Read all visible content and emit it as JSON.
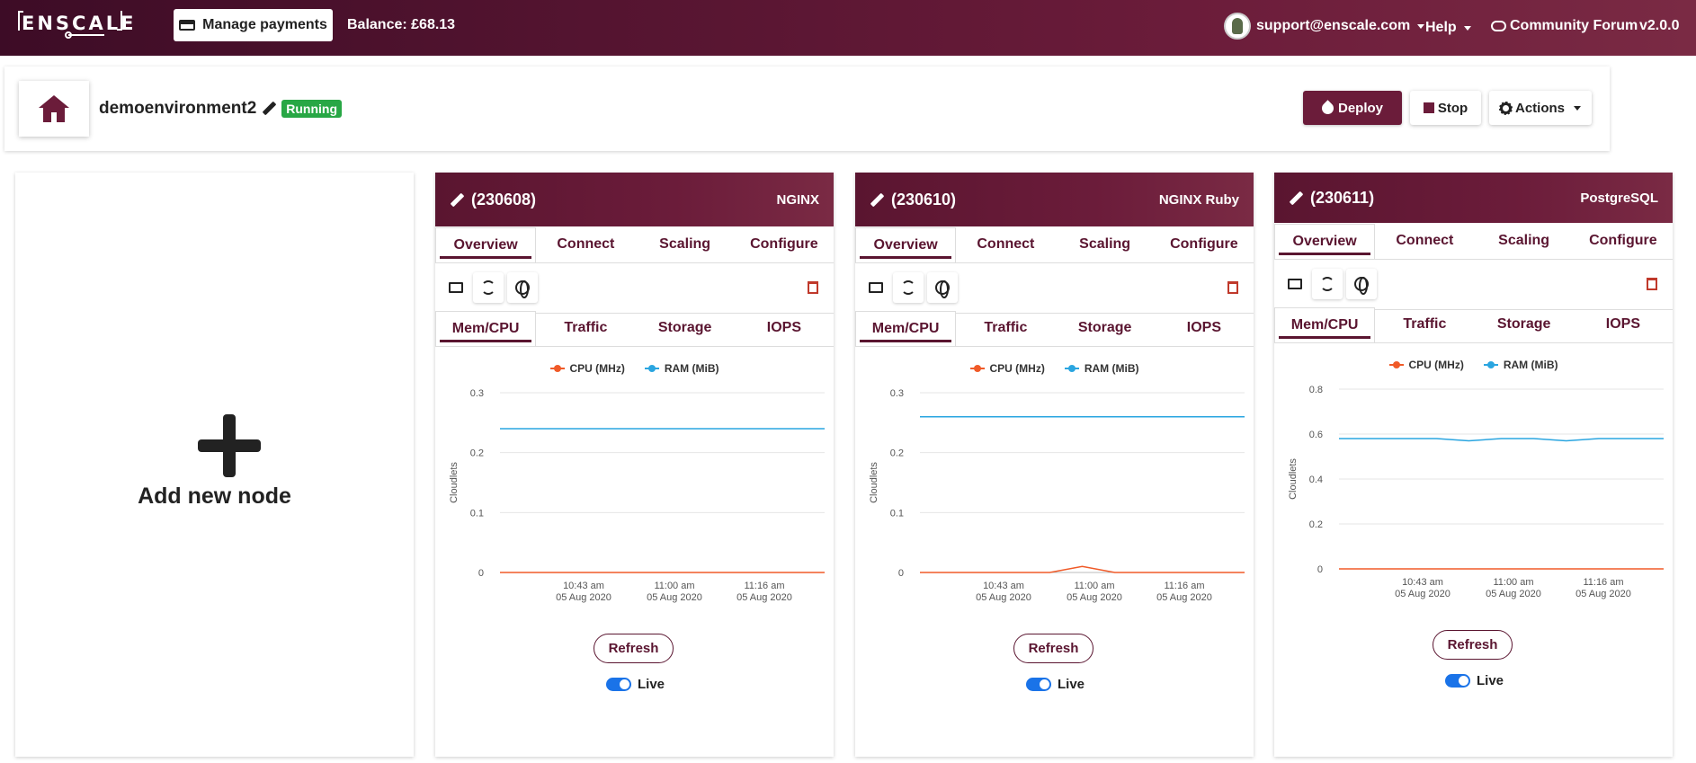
{
  "nav": {
    "logo": "ENSCALE",
    "manage_payments": "Manage payments",
    "balance": "Balance: £68.13",
    "user": "support@enscale.com",
    "help": "Help",
    "forum": "Community Forum",
    "version": "v2.0.0"
  },
  "env": {
    "name": "demoenvironment2",
    "status": "Running",
    "deploy": "Deploy",
    "stop": "Stop",
    "actions": "Actions"
  },
  "add_node": {
    "label": "Add new node"
  },
  "colors": {
    "brand": "#6b1c3a",
    "cpu": "#f05a28",
    "ram": "#2aa5e0",
    "running": "#28a745"
  },
  "nodes": [
    {
      "id": "(230608)",
      "type": "NGINX",
      "tabs": [
        "Overview",
        "Connect",
        "Scaling",
        "Configure"
      ],
      "metric_tabs": [
        "Mem/CPU",
        "Traffic",
        "Storage",
        "IOPS"
      ],
      "legend": [
        "CPU (MHz)",
        "RAM (MiB)"
      ],
      "refresh": "Refresh",
      "live": "Live",
      "chart_data": {
        "type": "line",
        "ylabel": "Cloudlets",
        "yticks": [
          "0.3",
          "0.2",
          "0.1",
          "0"
        ],
        "ylim": [
          0,
          0.3
        ],
        "xticks": [
          [
            "10:43 am",
            "05 Aug 2020"
          ],
          [
            "11:00 am",
            "05 Aug 2020"
          ],
          [
            "11:16 am",
            "05 Aug 2020"
          ]
        ],
        "series": [
          {
            "name": "CPU (MHz)",
            "values": [
              0,
              0,
              0,
              0,
              0,
              0,
              0,
              0,
              0,
              0,
              0
            ]
          },
          {
            "name": "RAM (MiB)",
            "values": [
              0.24,
              0.24,
              0.24,
              0.24,
              0.24,
              0.24,
              0.24,
              0.24,
              0.24,
              0.24,
              0.24
            ]
          }
        ]
      }
    },
    {
      "id": "(230610)",
      "type": "NGINX Ruby",
      "tabs": [
        "Overview",
        "Connect",
        "Scaling",
        "Configure"
      ],
      "metric_tabs": [
        "Mem/CPU",
        "Traffic",
        "Storage",
        "IOPS"
      ],
      "legend": [
        "CPU (MHz)",
        "RAM (MiB)"
      ],
      "refresh": "Refresh",
      "live": "Live",
      "chart_data": {
        "type": "line",
        "ylabel": "Cloudlets",
        "yticks": [
          "0.3",
          "0.2",
          "0.1",
          "0"
        ],
        "ylim": [
          0,
          0.3
        ],
        "xticks": [
          [
            "10:43 am",
            "05 Aug 2020"
          ],
          [
            "11:00 am",
            "05 Aug 2020"
          ],
          [
            "11:16 am",
            "05 Aug 2020"
          ]
        ],
        "series": [
          {
            "name": "CPU (MHz)",
            "values": [
              0,
              0,
              0,
              0,
              0,
              0.01,
              0,
              0,
              0,
              0,
              0
            ]
          },
          {
            "name": "RAM (MiB)",
            "values": [
              0.26,
              0.26,
              0.26,
              0.26,
              0.26,
              0.26,
              0.26,
              0.26,
              0.26,
              0.26,
              0.26
            ]
          }
        ]
      }
    },
    {
      "id": "(230611)",
      "type": "PostgreSQL",
      "tabs": [
        "Overview",
        "Connect",
        "Scaling",
        "Configure"
      ],
      "metric_tabs": [
        "Mem/CPU",
        "Traffic",
        "Storage",
        "IOPS"
      ],
      "legend": [
        "CPU (MHz)",
        "RAM (MiB)"
      ],
      "refresh": "Refresh",
      "live": "Live",
      "chart_data": {
        "type": "line",
        "ylabel": "Cloudlets",
        "yticks": [
          "0.8",
          "0.6",
          "0.4",
          "0.2",
          "0"
        ],
        "ylim": [
          0,
          0.8
        ],
        "xticks": [
          [
            "10:43 am",
            "05 Aug 2020"
          ],
          [
            "11:00 am",
            "05 Aug 2020"
          ],
          [
            "11:16 am",
            "05 Aug 2020"
          ]
        ],
        "series": [
          {
            "name": "CPU (MHz)",
            "values": [
              0,
              0,
              0,
              0,
              0,
              0,
              0,
              0,
              0,
              0,
              0
            ]
          },
          {
            "name": "RAM (MiB)",
            "values": [
              0.58,
              0.58,
              0.58,
              0.58,
              0.57,
              0.58,
              0.58,
              0.57,
              0.58,
              0.58,
              0.58
            ]
          }
        ]
      }
    }
  ]
}
